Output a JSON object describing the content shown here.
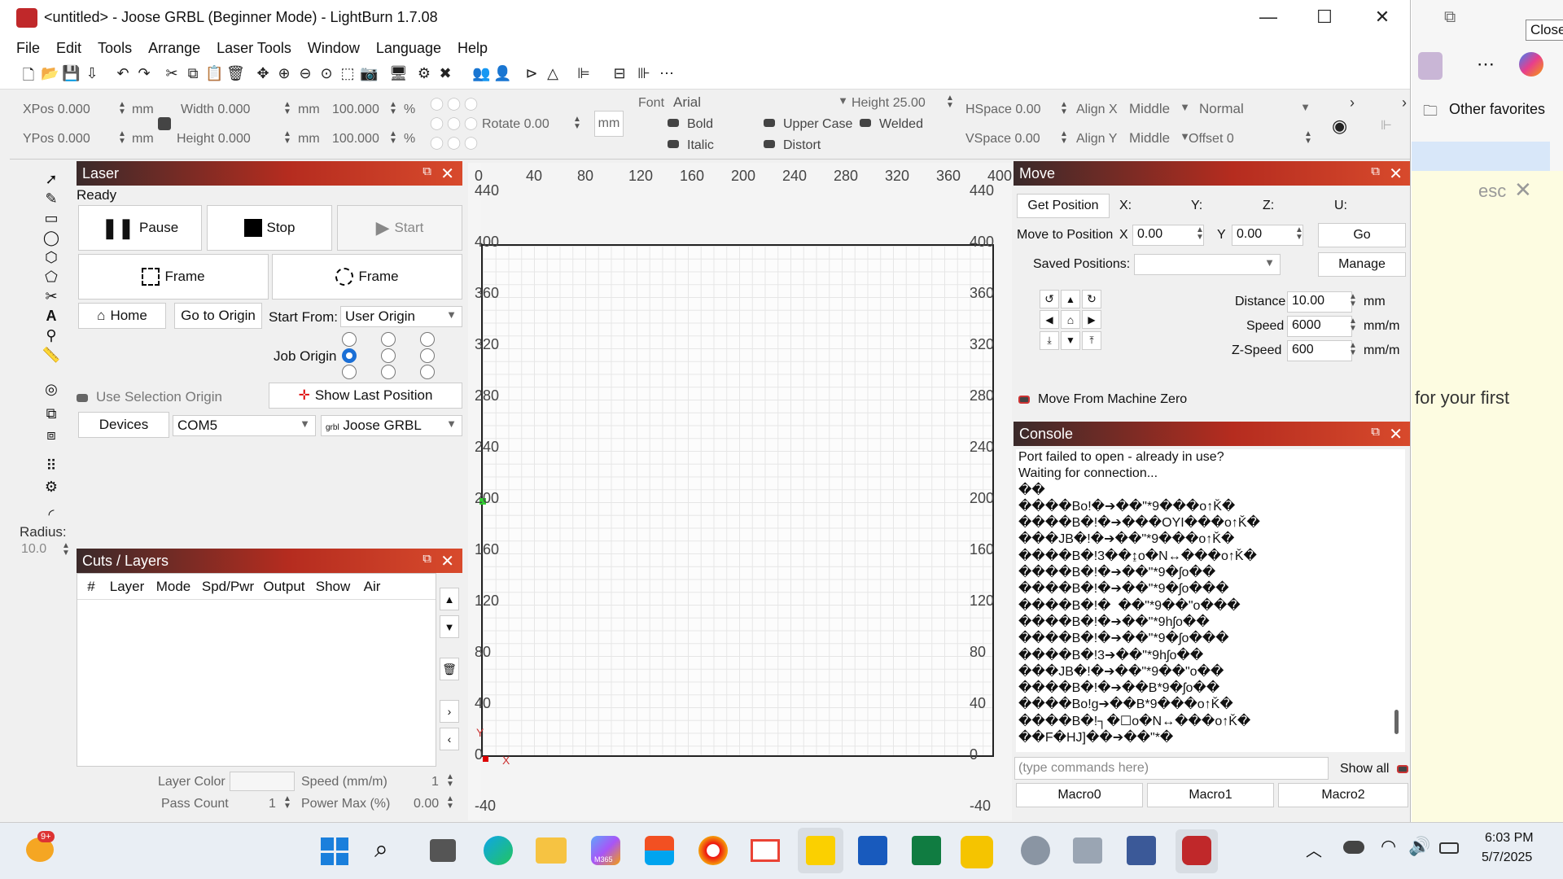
{
  "window": {
    "title": "<untitled> - Joose GRBL (Beginner Mode) - LightBurn 1.7.08"
  },
  "menu": [
    "File",
    "Edit",
    "Tools",
    "Arrange",
    "Laser Tools",
    "Window",
    "Language",
    "Help"
  ],
  "props": {
    "xpos": "XPos 0.000",
    "ypos": "YPos 0.000",
    "mm": "mm",
    "width": "Width 0.000",
    "height": "Height 0.000",
    "pct1": "100.000",
    "pct2": "100.000",
    "pct": "%",
    "rotate": "Rotate 0.00",
    "unit_btn": "mm",
    "font_label": "Font",
    "font": "Arial",
    "font_height": "Height 25.00",
    "hspace": "HSpace 0.00",
    "vspace": "VSpace 0.00",
    "alignx": "Align X",
    "alignx_val": "Middle",
    "aligny": "Align Y",
    "aligny_val": "Middle",
    "normal": "Normal",
    "offset": "Offset 0",
    "bold": "Bold",
    "italic": "Italic",
    "upper": "Upper Case",
    "distort": "Distort",
    "welded": "Welded"
  },
  "laser": {
    "title": "Laser",
    "status": "Ready",
    "pause": "Pause",
    "stop": "Stop",
    "start": "Start",
    "frame1": "Frame",
    "frame2": "Frame",
    "home": "Home",
    "go_origin": "Go to Origin",
    "start_from_label": "Start From:",
    "start_from": "User Origin",
    "job_origin": "Job Origin",
    "use_sel": "Use Selection Origin",
    "show_last": "Show Last Position",
    "devices": "Devices",
    "port": "COM5",
    "device": "Joose GRBL",
    "grbl_prefix": "grbl"
  },
  "radius": {
    "label": "Radius:",
    "value": "10.0"
  },
  "cuts": {
    "title": "Cuts / Layers",
    "cols": [
      "#",
      "Layer",
      "Mode",
      "Spd/Pwr",
      "Output",
      "Show",
      "Air"
    ],
    "layer_color": "Layer Color",
    "speed_label": "Speed (mm/m)",
    "speed": "1",
    "pass_label": "Pass Count",
    "pass": "1",
    "power_label": "Power Max (%)",
    "power": "0.00"
  },
  "canvas": {
    "top_ticks": [
      "0",
      "40",
      "80",
      "120",
      "160",
      "200",
      "240",
      "280",
      "320",
      "360",
      "400"
    ],
    "side_ticks": [
      "440",
      "400",
      "360",
      "320",
      "280",
      "240",
      "200",
      "160",
      "120",
      "80",
      "40",
      "0",
      "-40"
    ],
    "axis_x": "X",
    "axis_y": "Y"
  },
  "move": {
    "title": "Move",
    "get_pos": "Get Position",
    "x": "X:",
    "y": "Y:",
    "z": "Z:",
    "u": "U:",
    "move_to": "Move to Position",
    "mx_label": "X",
    "mx": "0.00",
    "my_label": "Y",
    "my": "0.00",
    "go": "Go",
    "saved": "Saved Positions:",
    "manage": "Manage",
    "distance_label": "Distance",
    "distance": "10.00",
    "speed_label": "Speed",
    "speed": "6000",
    "zspeed_label": "Z-Speed",
    "zspeed": "600",
    "unit_mm": "mm",
    "unit_mmm": "mm/m",
    "from_zero": "Move From Machine Zero"
  },
  "console": {
    "title": "Console",
    "lines": "Port failed to open - already in use?\nWaiting for connection...\n��\n����Bo!�➔��\"*9���o↑Ǩ�\n����B�!�➔���OYI���o↑Ǩ�\n���JB�!�➔��\"*9���o↑Ǩ�\n����B�!3��↨o�N↔���o↑Ǩ�\n����B�!�➔��\"*9�ʃo��\n����B�!�➔��\"*9�ʃo���\n����B�!�  ��\"*9��\"o���\n����B�!�➔��\"*9hʃo��\n����B�!�➔��\"*9�ʃo���\n����B�!3➔��\"*9hʃo��\n���JB�!�➔��\"*9��\"o��\n����B�!�➔��B*9�ʃo��\n����Bo!g➔��B*9���o↑Ǩ�\n����B�!┐�☐o�N↔���o↑Ǩ�\n��F�HJ]��➔��\"*�",
    "placeholder": "(type commands here)",
    "show_all": "Show all",
    "macros": [
      "Macro0",
      "Macro1",
      "Macro2"
    ]
  },
  "edge": {
    "other_fav": "Other favorites",
    "esc": "esc",
    "first": "for your first",
    "close_tip": "Close"
  },
  "taskbar": {
    "badge": "9+",
    "time": "6:03 PM",
    "date": "5/7/2025",
    "m365": "M365"
  }
}
